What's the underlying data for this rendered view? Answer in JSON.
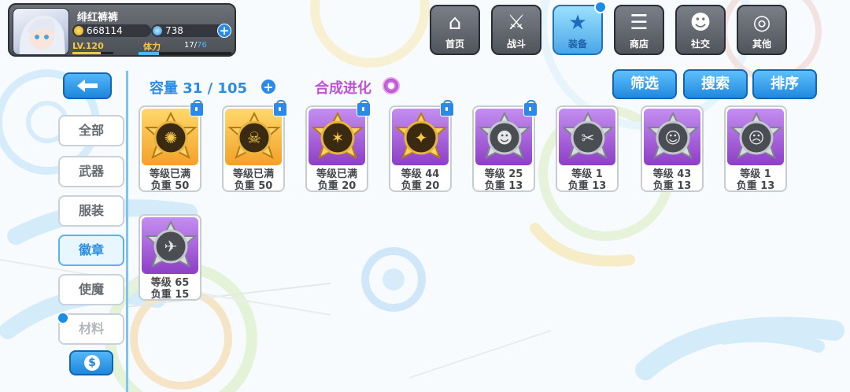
{
  "player": {
    "name": "绯红裤裤",
    "gold": "668114",
    "gems": "738",
    "level": "LV.120",
    "level_progress": 0.7,
    "stamina_label": "体力",
    "stamina_current": "17",
    "stamina_sep": "/",
    "stamina_max": "76",
    "stamina_progress": 0.22
  },
  "nav": [
    {
      "label": "首页",
      "icon": "house-icon",
      "glyph": "⌂",
      "active": false
    },
    {
      "label": "战斗",
      "icon": "crossed-swords-icon",
      "glyph": "⚔",
      "active": false
    },
    {
      "label": "装备",
      "icon": "star-icon",
      "glyph": "★",
      "active": true
    },
    {
      "label": "商店",
      "icon": "cart-icon",
      "glyph": "☰",
      "active": false
    },
    {
      "label": "社交",
      "icon": "people-icon",
      "glyph": "☻",
      "active": false
    },
    {
      "label": "其他",
      "icon": "more-icon",
      "glyph": "◎",
      "active": false
    }
  ],
  "sidebar": {
    "categories": [
      "全部",
      "武器",
      "服装",
      "徽章",
      "使魔",
      "材料"
    ],
    "active": "徽章"
  },
  "capacity": {
    "text": "容量 31 / 105"
  },
  "synthesis": {
    "text": "合成进化"
  },
  "toolbar": {
    "filter": "筛选",
    "search": "搜索",
    "sort": "排序"
  },
  "items": [
    {
      "rarity": "gold",
      "line1": "等级已满",
      "line2": "负重 50",
      "locked": true
    },
    {
      "rarity": "gold",
      "line1": "等级已满",
      "line2": "负重 50",
      "locked": true
    },
    {
      "rarity": "purple",
      "line1": "等级已满",
      "line2": "负重 20",
      "locked": true
    },
    {
      "rarity": "purple",
      "line1": "等级 44",
      "line2": "负重 20",
      "locked": true
    },
    {
      "rarity": "purple",
      "line1": "等级 25",
      "line2": "负重 13",
      "locked": true
    },
    {
      "rarity": "purple",
      "line1": "等级 1",
      "line2": "负重 13",
      "locked": false
    },
    {
      "rarity": "purple",
      "line1": "等级 43",
      "line2": "负重 13",
      "locked": false
    },
    {
      "rarity": "purple",
      "line1": "等级 1",
      "line2": "负重 13",
      "locked": false
    },
    {
      "rarity": "purple",
      "line1": "等级 65",
      "line2": "负重 15",
      "locked": false
    }
  ],
  "colors": {
    "accent": "#2a8de2",
    "gold": "#f3a12a",
    "purple": "#8d3fc6",
    "synth": "#c050d6"
  }
}
